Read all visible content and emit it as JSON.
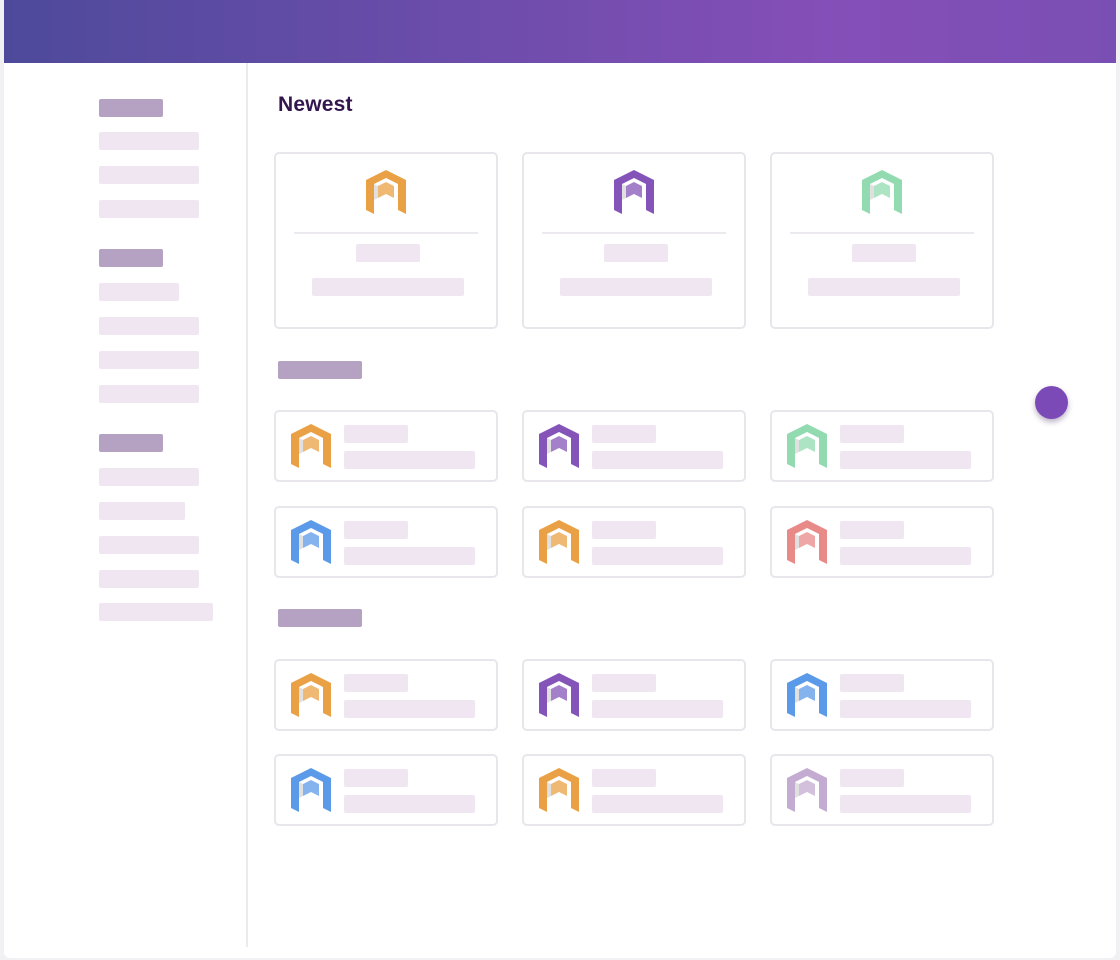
{
  "header": {
    "gradient_start": "#4e4a9b",
    "gradient_mid": "#854fb8",
    "gradient_end": "#7a4fb4"
  },
  "main": {
    "newest_title": "Newest"
  },
  "fab": {
    "color": "#7b4ab6",
    "icon": "circle-button"
  },
  "colors": {
    "orange": "#eaa145",
    "purple": "#8554b8",
    "green": "#92dbb0",
    "blue": "#5b9ae8",
    "red": "#e88a88",
    "lavender": "#c3abd2"
  },
  "sections": {
    "newest": {
      "logos": [
        "orange",
        "purple",
        "green"
      ]
    },
    "section_two": {
      "logos": [
        "orange",
        "purple",
        "green",
        "blue",
        "orange",
        "red"
      ]
    },
    "section_three": {
      "logos": [
        "orange",
        "purple",
        "blue",
        "blue",
        "orange",
        "lavender"
      ]
    }
  }
}
